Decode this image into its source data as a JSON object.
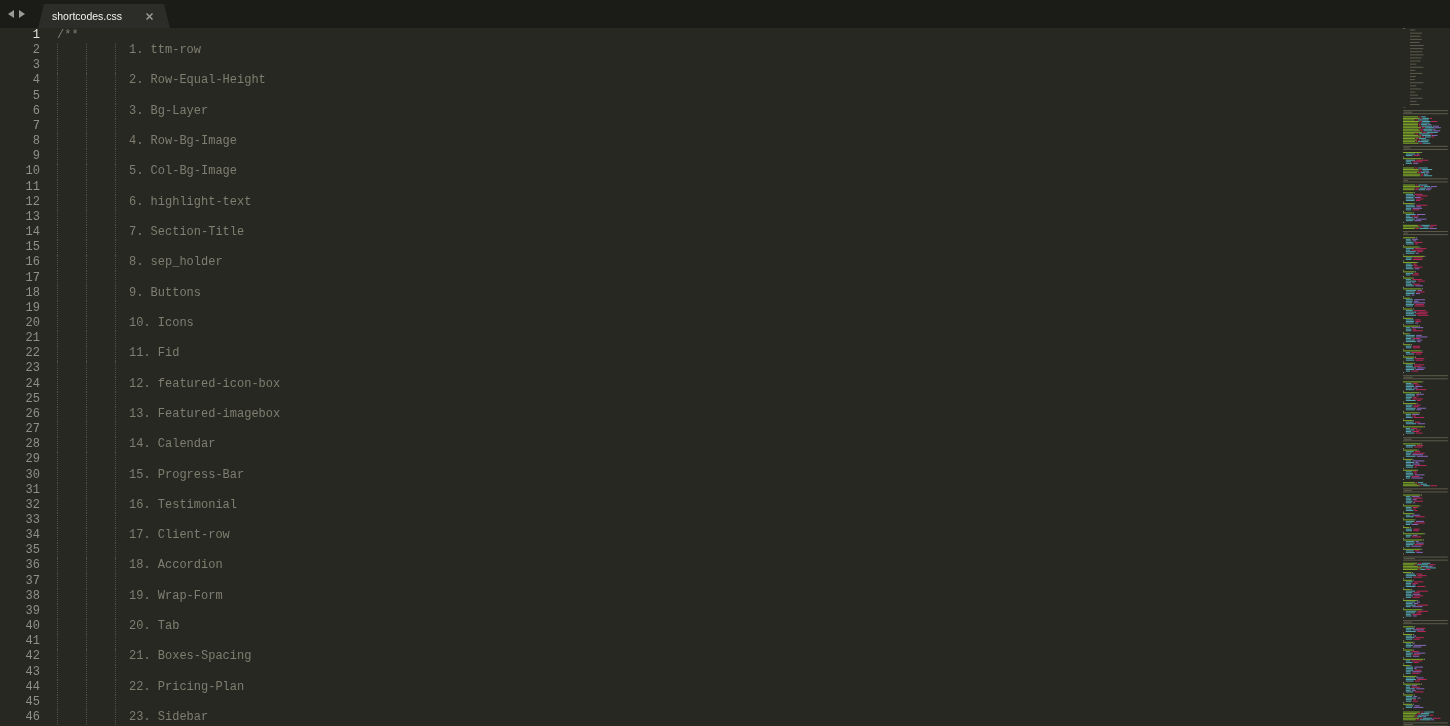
{
  "tabs": [
    {
      "label": "shortcodes.css",
      "selected": true
    }
  ],
  "editor": {
    "lines": [
      {
        "number": "1",
        "current": true,
        "kind": "comment_open",
        "text": "/**"
      },
      {
        "number": "2",
        "current": false,
        "kind": "list_item",
        "text": "1. ttm-row"
      },
      {
        "number": "3",
        "current": false,
        "kind": "blank"
      },
      {
        "number": "4",
        "current": false,
        "kind": "list_item",
        "text": "2. Row-Equal-Height"
      },
      {
        "number": "5",
        "current": false,
        "kind": "blank"
      },
      {
        "number": "6",
        "current": false,
        "kind": "list_item",
        "text": "3. Bg-Layer"
      },
      {
        "number": "7",
        "current": false,
        "kind": "blank"
      },
      {
        "number": "8",
        "current": false,
        "kind": "list_item",
        "text": "4. Row-Bg-Image"
      },
      {
        "number": "9",
        "current": false,
        "kind": "blank"
      },
      {
        "number": "10",
        "current": false,
        "kind": "list_item",
        "text": "5. Col-Bg-Image"
      },
      {
        "number": "11",
        "current": false,
        "kind": "blank"
      },
      {
        "number": "12",
        "current": false,
        "kind": "list_item",
        "text": "6. highlight-text"
      },
      {
        "number": "13",
        "current": false,
        "kind": "blank"
      },
      {
        "number": "14",
        "current": false,
        "kind": "list_item",
        "text": "7. Section-Title"
      },
      {
        "number": "15",
        "current": false,
        "kind": "blank"
      },
      {
        "number": "16",
        "current": false,
        "kind": "list_item",
        "text": "8. sep_holder"
      },
      {
        "number": "17",
        "current": false,
        "kind": "blank"
      },
      {
        "number": "18",
        "current": false,
        "kind": "list_item",
        "text": "9. Buttons"
      },
      {
        "number": "19",
        "current": false,
        "kind": "blank"
      },
      {
        "number": "20",
        "current": false,
        "kind": "list_item",
        "text": "10. Icons"
      },
      {
        "number": "21",
        "current": false,
        "kind": "blank"
      },
      {
        "number": "22",
        "current": false,
        "kind": "list_item",
        "text": "11. Fid"
      },
      {
        "number": "23",
        "current": false,
        "kind": "blank"
      },
      {
        "number": "24",
        "current": false,
        "kind": "list_item",
        "text": "12. featured-icon-box"
      },
      {
        "number": "25",
        "current": false,
        "kind": "blank"
      },
      {
        "number": "26",
        "current": false,
        "kind": "list_item",
        "text": "13. Featured-imagebox"
      },
      {
        "number": "27",
        "current": false,
        "kind": "blank"
      },
      {
        "number": "28",
        "current": false,
        "kind": "list_item",
        "text": "14. Calendar"
      },
      {
        "number": "29",
        "current": false,
        "kind": "blank"
      },
      {
        "number": "30",
        "current": false,
        "kind": "list_item",
        "text": "15. Progress-Bar"
      },
      {
        "number": "31",
        "current": false,
        "kind": "blank"
      },
      {
        "number": "32",
        "current": false,
        "kind": "list_item",
        "text": "16. Testimonial"
      },
      {
        "number": "33",
        "current": false,
        "kind": "blank"
      },
      {
        "number": "34",
        "current": false,
        "kind": "list_item",
        "text": "17. Client-row"
      },
      {
        "number": "35",
        "current": false,
        "kind": "blank"
      },
      {
        "number": "36",
        "current": false,
        "kind": "list_item",
        "text": "18. Accordion"
      },
      {
        "number": "37",
        "current": false,
        "kind": "blank"
      },
      {
        "number": "38",
        "current": false,
        "kind": "list_item",
        "text": "19. Wrap-Form"
      },
      {
        "number": "39",
        "current": false,
        "kind": "blank"
      },
      {
        "number": "40",
        "current": false,
        "kind": "list_item",
        "text": "20. Tab"
      },
      {
        "number": "41",
        "current": false,
        "kind": "blank"
      },
      {
        "number": "42",
        "current": false,
        "kind": "list_item",
        "text": "21. Boxes-Spacing"
      },
      {
        "number": "43",
        "current": false,
        "kind": "blank"
      },
      {
        "number": "44",
        "current": false,
        "kind": "list_item",
        "text": "22. Pricing-Plan"
      },
      {
        "number": "45",
        "current": false,
        "kind": "blank"
      },
      {
        "number": "46",
        "current": false,
        "kind": "list_item",
        "text": "23. Sidebar"
      }
    ]
  }
}
